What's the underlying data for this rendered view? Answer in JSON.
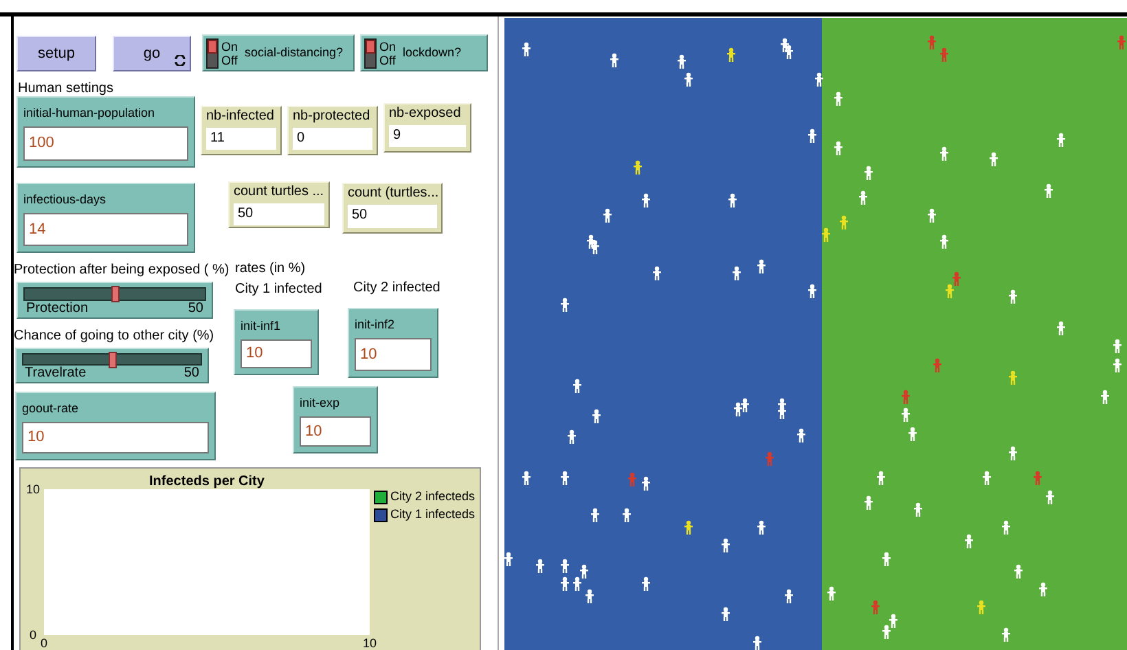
{
  "widgets": [
    {
      "kind": "button",
      "label": "setup",
      "forever": false
    },
    {
      "kind": "button",
      "label": "go",
      "forever": true
    },
    {
      "kind": "switch",
      "label": "social-distancing?",
      "on": true,
      "on_text": "On",
      "off_text": "Off"
    },
    {
      "kind": "switch",
      "label": "lockdown?",
      "on": true,
      "on_text": "On",
      "off_text": "Off"
    },
    {
      "kind": "note",
      "text": "Human settings"
    },
    {
      "kind": "input",
      "label": "initial-human-population",
      "value": "100"
    },
    {
      "kind": "monitor",
      "label": "nb-infected",
      "value": "11"
    },
    {
      "kind": "monitor",
      "label": "nb-protected",
      "value": "0"
    },
    {
      "kind": "monitor",
      "label": "nb-exposed",
      "value": "9"
    },
    {
      "kind": "input",
      "label": "infectious-days",
      "value": "14"
    },
    {
      "kind": "monitor",
      "label": "count turtles ...",
      "value": "50"
    },
    {
      "kind": "monitor",
      "label": "count (turtles...",
      "value": "50"
    },
    {
      "kind": "note",
      "text": "Protection after being exposed ( %)"
    },
    {
      "kind": "note",
      "text": "rates (in %)"
    },
    {
      "kind": "slider",
      "label": "Protection",
      "value": "50",
      "level": 0.5
    },
    {
      "kind": "note",
      "text": "City 1 infected"
    },
    {
      "kind": "note",
      "text": "City 2 infected"
    },
    {
      "kind": "note",
      "text": "Chance of going to other city (%)"
    },
    {
      "kind": "input",
      "label": "init-inf1",
      "value": "10"
    },
    {
      "kind": "input",
      "label": "init-inf2",
      "value": "10"
    },
    {
      "kind": "slider",
      "label": "Travelrate",
      "value": "50",
      "level": 0.5
    },
    {
      "kind": "input",
      "label": "goout-rate",
      "value": "10"
    },
    {
      "kind": "input",
      "label": "init-exp",
      "value": "10"
    }
  ],
  "plot": {
    "y_axis_labels": [
      "10",
      "0"
    ],
    "x_axis_labels": [
      "0",
      "10"
    ],
    "chart_data": {
      "type": "other",
      "title": "Infecteds per City",
      "series": [
        {
          "name": "City 2 infecteds",
          "color": "#1fae3a"
        },
        {
          "name": "City 1 infecteds",
          "color": "#2c4d96"
        }
      ]
    }
  }
}
